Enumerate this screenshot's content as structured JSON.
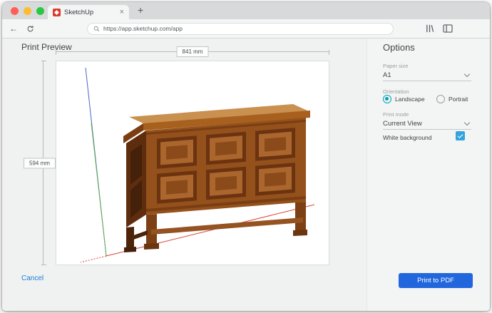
{
  "browser": {
    "tab_title": "SketchUp",
    "url": "https://app.sketchup.com/app"
  },
  "print_preview": {
    "title": "Print Preview",
    "cancel_label": "Cancel",
    "width_dimension": "841 mm",
    "height_dimension": "594 mm"
  },
  "options_panel": {
    "title": "Options",
    "paper_size": {
      "label": "Paper size",
      "value": "A1"
    },
    "orientation": {
      "label": "Orientation",
      "options": [
        {
          "label": "Landscape",
          "selected": true
        },
        {
          "label": "Portrait",
          "selected": false
        }
      ]
    },
    "print_mode": {
      "label": "Print mode",
      "value": "Current View"
    },
    "white_background": {
      "label": "White background",
      "checked": true
    },
    "print_button_label": "Print to PDF"
  },
  "colors": {
    "accent_teal": "#00a3b4",
    "primary_button": "#2266dd",
    "link": "#1b7fd4",
    "checkbox_blue": "#35a3dc",
    "axis_red": "#d8453a",
    "axis_green": "#69b54c",
    "axis_blue": "#4d61d1"
  }
}
